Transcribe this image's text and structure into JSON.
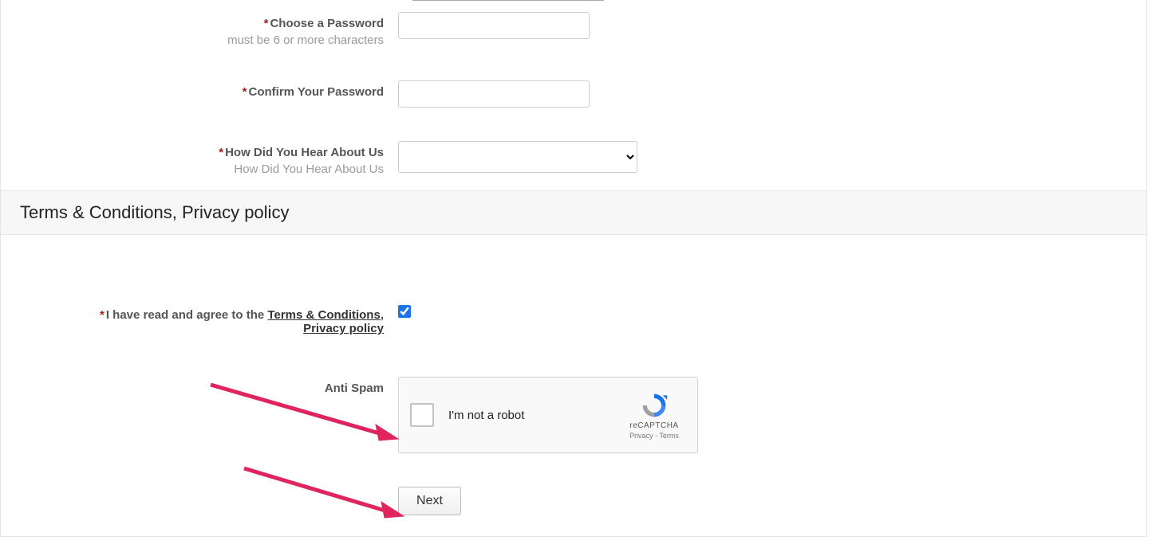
{
  "fields": {
    "password": {
      "label": "Choose a Password",
      "hint": "must be 6 or more characters",
      "value": ""
    },
    "confirm_password": {
      "label": "Confirm Your Password",
      "value": ""
    },
    "hear_about": {
      "label": "How Did You Hear About Us",
      "hint": "How Did You Hear About Us",
      "selected": ""
    }
  },
  "section": {
    "terms_header": "Terms & Conditions, Privacy policy"
  },
  "terms": {
    "prefix": "I have read and agree to the ",
    "terms_link": "Terms & Conditions",
    "separator": ", ",
    "privacy_link": "Privacy policy",
    "checked": true
  },
  "antispam": {
    "label": "Anti Spam",
    "recaptcha_text": "I'm not a robot",
    "brand": "reCAPTCHA",
    "privacy": "Privacy",
    "dash": " - ",
    "terms": "Terms"
  },
  "buttons": {
    "next": "Next"
  },
  "required_mark": "*"
}
